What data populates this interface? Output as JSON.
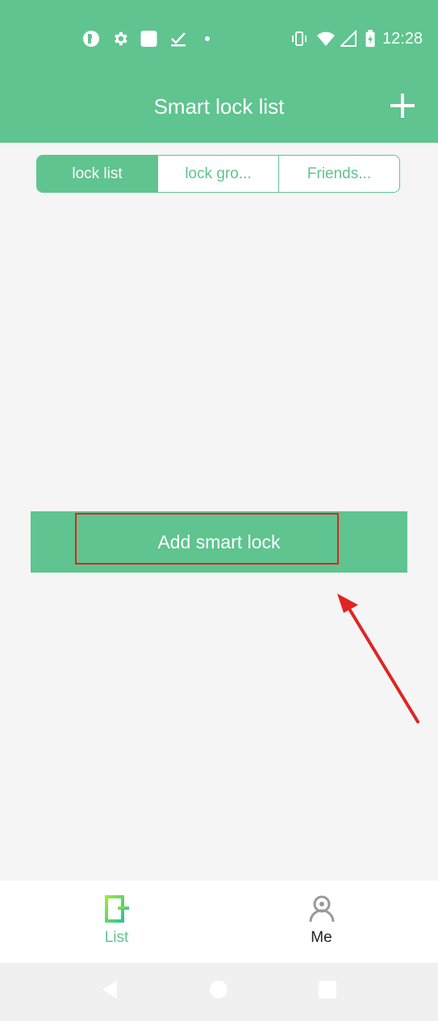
{
  "status_bar": {
    "time": "12:28",
    "left_icons": [
      "app-icon",
      "settings-icon",
      "square-app-icon",
      "check-icon",
      "dot-icon"
    ],
    "right_icons": [
      "vibrate-icon",
      "wifi-icon",
      "signal-icon",
      "battery-charging-icon"
    ]
  },
  "header": {
    "title": "Smart lock list",
    "add_icon": "plus-icon"
  },
  "tabs": [
    {
      "label": "lock list",
      "active": true
    },
    {
      "label": "lock gro...",
      "active": false
    },
    {
      "label": "Friends...",
      "active": false
    }
  ],
  "main": {
    "add_button_label": "Add smart lock"
  },
  "bottom_nav": [
    {
      "label": "List",
      "icon": "door-list-icon",
      "active": true
    },
    {
      "label": "Me",
      "icon": "person-icon",
      "active": false
    }
  ],
  "system_nav": [
    "back-icon",
    "home-icon",
    "recents-icon"
  ],
  "colors": {
    "brand": "#5fc48f",
    "highlight": "#e02424",
    "background": "#f5f5f5"
  }
}
